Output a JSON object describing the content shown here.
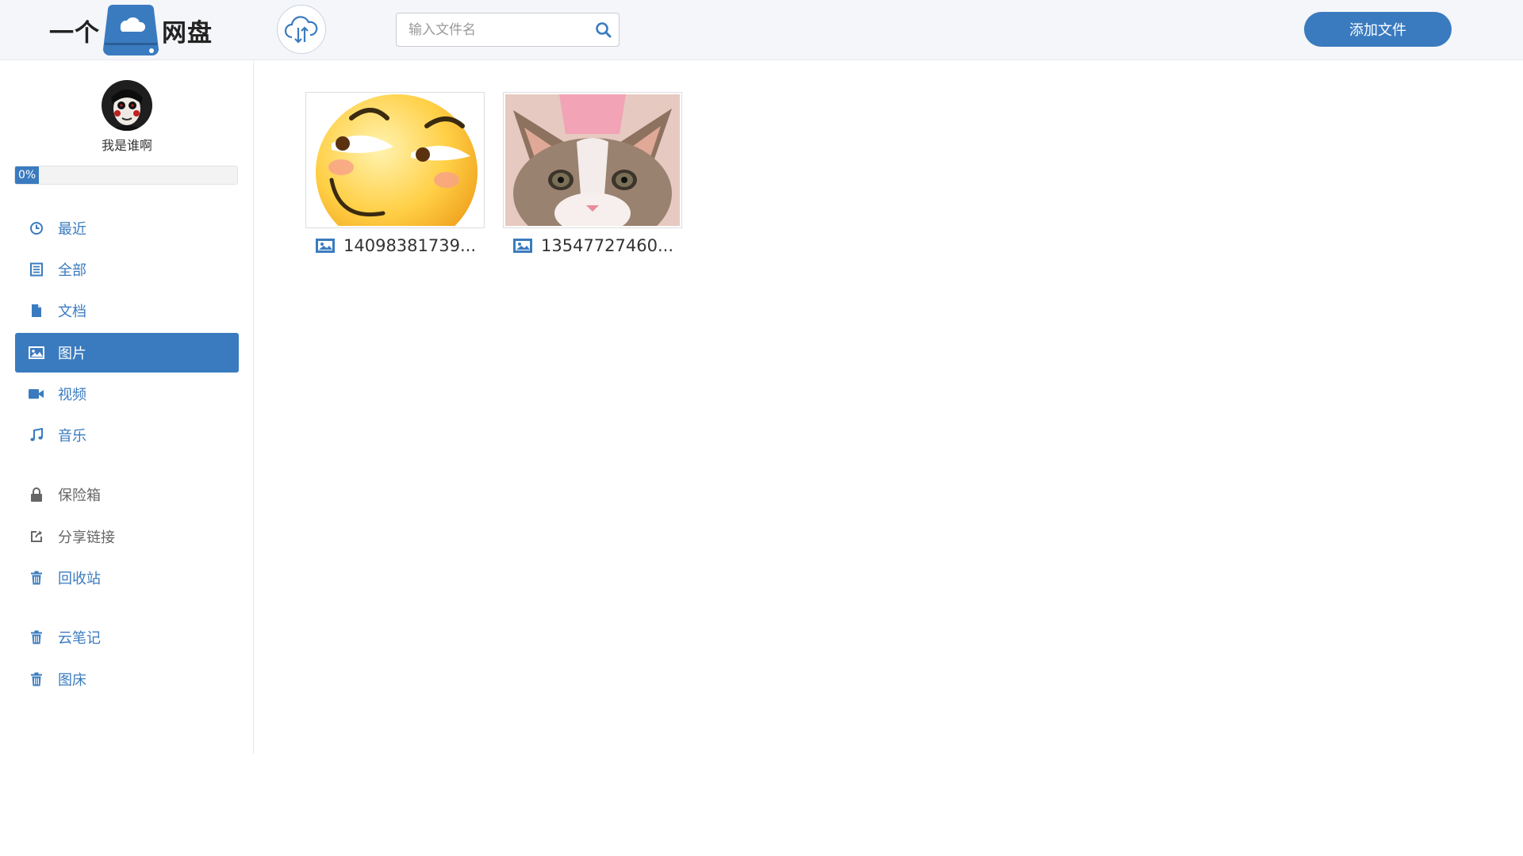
{
  "header": {
    "logo_left": "一个",
    "logo_right": "网盘",
    "search": {
      "placeholder": "输入文件名",
      "value": ""
    },
    "add_button": "添加文件"
  },
  "user": {
    "name": "我是谁啊",
    "quota_label": "0%",
    "quota_fraction": 0
  },
  "menu": {
    "items": [
      {
        "label": "最近",
        "icon": "clock-icon"
      },
      {
        "label": "全部",
        "icon": "list-icon"
      },
      {
        "label": "文档",
        "icon": "document-icon"
      },
      {
        "label": "图片",
        "icon": "image-icon",
        "active": true
      },
      {
        "label": "视频",
        "icon": "video-camera-icon"
      },
      {
        "label": "音乐",
        "icon": "music-note-icon"
      },
      {
        "label": "保险箱",
        "icon": "lock-icon"
      },
      {
        "label": "分享链接",
        "icon": "share-icon"
      },
      {
        "label": "回收站",
        "icon": "trash-icon"
      },
      {
        "label": "云笔记",
        "icon": "trash-icon"
      },
      {
        "label": "图床",
        "icon": "trash-icon"
      }
    ]
  },
  "files": [
    {
      "name": "14098381739...",
      "type_icon": "image-icon"
    },
    {
      "name": "13547727460...",
      "type_icon": "image-icon"
    }
  ],
  "colors": {
    "accent": "#3a7bbf",
    "topbar_bg": "#f5f6f9",
    "muted_text": "#666666"
  }
}
